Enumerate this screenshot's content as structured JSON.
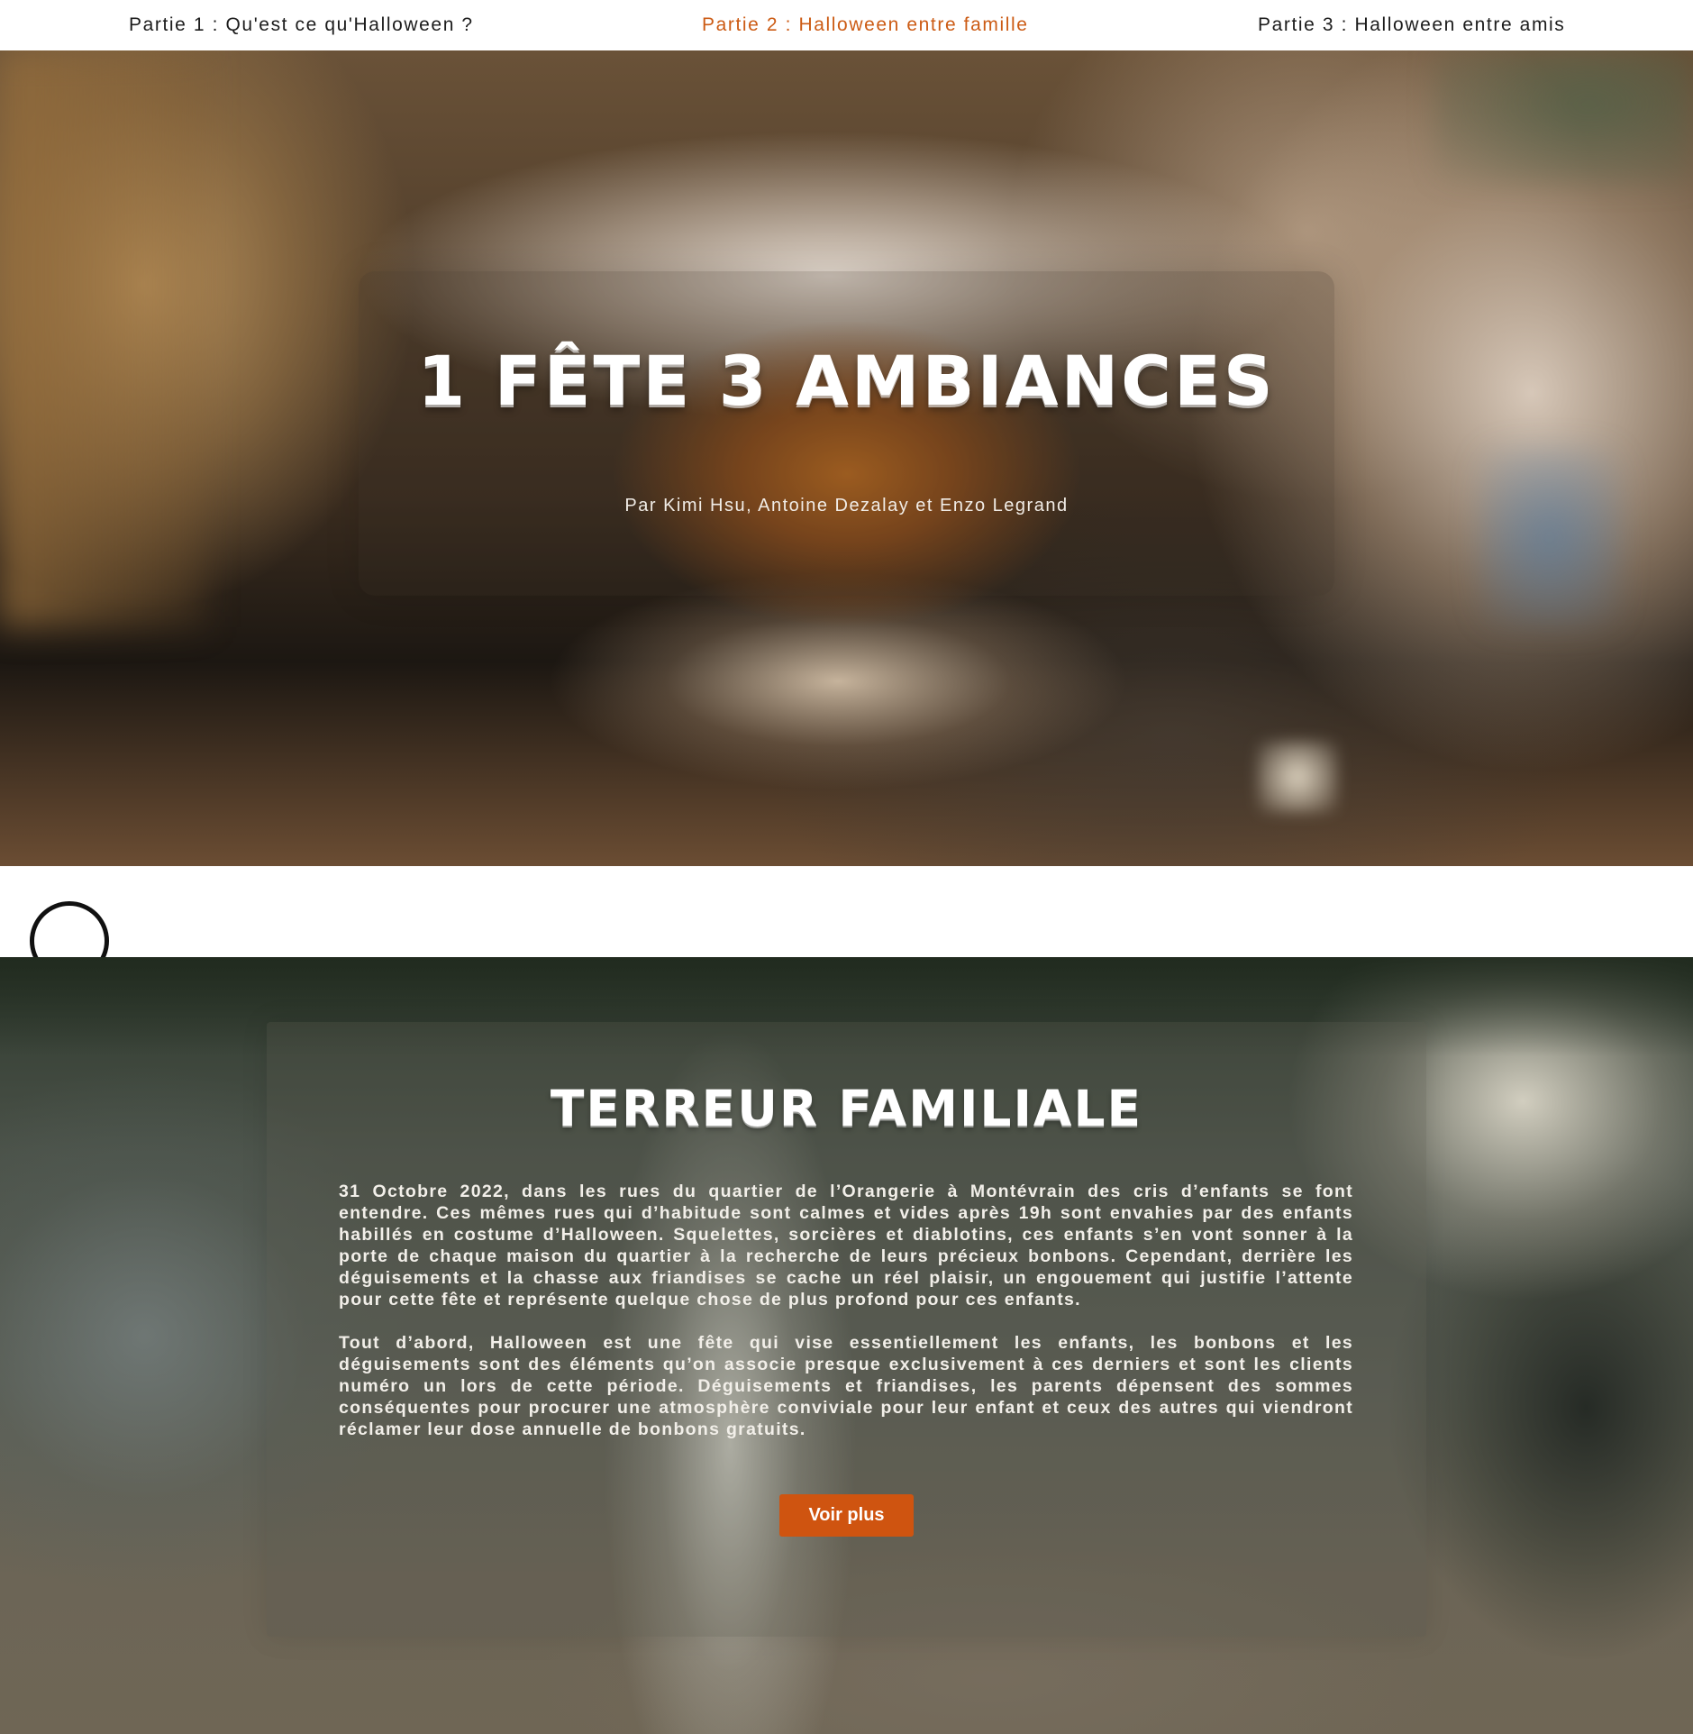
{
  "nav": {
    "items": [
      {
        "label": "Partie 1 : Qu'est ce qu'Halloween ?",
        "active": false
      },
      {
        "label": "Partie 2 : Halloween entre famille",
        "active": true
      },
      {
        "label": "Partie 3 : Halloween entre amis",
        "active": false
      }
    ]
  },
  "hero": {
    "title": "1 FÊTE 3 AMBIANCES",
    "authors": "Par Kimi Hsu, Antoine Dezalay et Enzo Legrand"
  },
  "section": {
    "title": "TERREUR FAMILIALE",
    "paragraphs": [
      "31 Octobre 2022, dans les rues du quartier de l’Orangerie à Montévrain des cris d’enfants se font entendre. Ces mêmes rues qui d’habitude sont calmes et vides après 19h sont envahies par des enfants habillés en costume d’Halloween. Squelettes, sorcières et diablotins, ces enfants s’en vont sonner à la porte de chaque maison du quartier à la recherche de leurs précieux bonbons. Cependant, derrière les déguisements et la chasse aux friandises se cache un réel plaisir, un engouement qui justifie l’attente pour cette fête et représente quelque chose de plus profond pour ces enfants.",
      "Tout d’abord, Halloween est une fête qui vise essentiellement les enfants, les bonbons et les déguisements sont des éléments qu’on associe presque exclusivement à ces derniers et sont les clients numéro un lors de cette période. Déguisements et friandises, les parents dépensent des sommes conséquentes pour procurer une atmosphère conviviale pour leur enfant et ceux des autres qui viendront réclamer leur dose annuelle de bonbons gratuits."
    ],
    "button_label": "Voir plus"
  },
  "colors": {
    "accent": "#cc5b14",
    "button": "#cf5410",
    "nav_text": "#1c1c1c",
    "title_text": "#ffffff"
  }
}
